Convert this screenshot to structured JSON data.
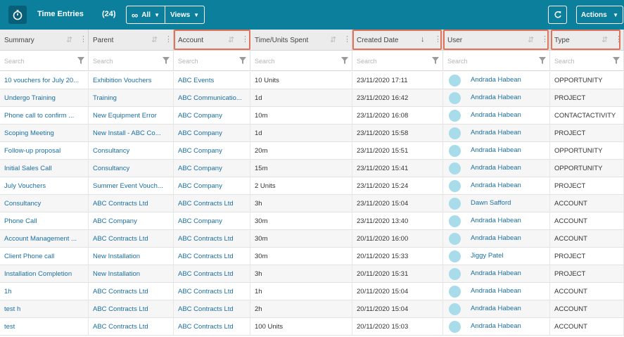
{
  "header": {
    "title": "Time Entries",
    "count": "(24)",
    "filter_label": "All",
    "views_label": "Views",
    "actions_label": "Actions",
    "timer_icon": "stopwatch-icon",
    "refresh_icon": "refresh-icon",
    "brand_color": "#0c7f9d"
  },
  "columns": [
    {
      "key": "summary",
      "label": "Summary",
      "search_placeholder": "Search"
    },
    {
      "key": "parent",
      "label": "Parent",
      "search_placeholder": "Search"
    },
    {
      "key": "account",
      "label": "Account",
      "search_placeholder": "Search"
    },
    {
      "key": "time",
      "label": "Time/Units Spent",
      "search_placeholder": "Search"
    },
    {
      "key": "created",
      "label": "Created Date",
      "search_placeholder": "Search"
    },
    {
      "key": "user",
      "label": "User",
      "search_placeholder": "Search"
    },
    {
      "key": "type",
      "label": "Type",
      "search_placeholder": "Search"
    }
  ],
  "highlight_color": "#e0735a",
  "rows": [
    {
      "summary": "10 vouchers for July 20...",
      "parent": "Exhibition Vouchers",
      "account": "ABC Events",
      "time": "10 Units",
      "created": "23/11/2020 17:11",
      "user": "Andrada Habean",
      "type": "OPPORTUNITY"
    },
    {
      "summary": "Undergo Training",
      "parent": "Training",
      "account": "ABC Communicatio...",
      "time": "1d",
      "created": "23/11/2020 16:42",
      "user": "Andrada Habean",
      "type": "PROJECT"
    },
    {
      "summary": "Phone call to confirm ...",
      "parent": "New Equipment Error",
      "account": "ABC Company",
      "time": "10m",
      "created": "23/11/2020 16:08",
      "user": "Andrada Habean",
      "type": "CONTACTACTIVITY"
    },
    {
      "summary": "Scoping Meeting",
      "parent": "New Install - ABC Co...",
      "account": "ABC Company",
      "time": "1d",
      "created": "23/11/2020 15:58",
      "user": "Andrada Habean",
      "type": "PROJECT"
    },
    {
      "summary": "Follow-up proposal",
      "parent": "Consultancy",
      "account": "ABC Company",
      "time": "20m",
      "created": "23/11/2020 15:51",
      "user": "Andrada Habean",
      "type": "OPPORTUNITY"
    },
    {
      "summary": "Initial Sales Call",
      "parent": "Consultancy",
      "account": "ABC Company",
      "time": "15m",
      "created": "23/11/2020 15:41",
      "user": "Andrada Habean",
      "type": "OPPORTUNITY"
    },
    {
      "summary": "July Vouchers",
      "parent": "Summer Event Vouch...",
      "account": "ABC Company",
      "time": "2 Units",
      "created": "23/11/2020 15:24",
      "user": "Andrada Habean",
      "type": "PROJECT"
    },
    {
      "summary": "Consultancy",
      "parent": "ABC Contracts Ltd",
      "account": "ABC Contracts Ltd",
      "time": "3h",
      "created": "23/11/2020 15:04",
      "user": "Dawn Safford",
      "type": "ACCOUNT"
    },
    {
      "summary": "Phone Call",
      "parent": "ABC Company",
      "account": "ABC Company",
      "time": "30m",
      "created": "23/11/2020 13:40",
      "user": "Andrada Habean",
      "type": "ACCOUNT"
    },
    {
      "summary": "Account Management ...",
      "parent": "ABC Contracts Ltd",
      "account": "ABC Contracts Ltd",
      "time": "30m",
      "created": "20/11/2020 16:00",
      "user": "Andrada Habean",
      "type": "ACCOUNT"
    },
    {
      "summary": "Client Phone call",
      "parent": "New Installation",
      "account": "ABC Contracts Ltd",
      "time": "30m",
      "created": "20/11/2020 15:33",
      "user": "Jiggy Patel",
      "type": "PROJECT"
    },
    {
      "summary": "Installation Completion",
      "parent": "New Installation",
      "account": "ABC Contracts Ltd",
      "time": "3h",
      "created": "20/11/2020 15:31",
      "user": "Andrada Habean",
      "type": "PROJECT"
    },
    {
      "summary": "1h",
      "parent": "ABC Contracts Ltd",
      "account": "ABC Contracts Ltd",
      "time": "1h",
      "created": "20/11/2020 15:04",
      "user": "Andrada Habean",
      "type": "ACCOUNT"
    },
    {
      "summary": "test h",
      "parent": "ABC Contracts Ltd",
      "account": "ABC Contracts Ltd",
      "time": "2h",
      "created": "20/11/2020 15:04",
      "user": "Andrada Habean",
      "type": "ACCOUNT"
    },
    {
      "summary": "test",
      "parent": "ABC Contracts Ltd",
      "account": "ABC Contracts Ltd",
      "time": "100 Units",
      "created": "20/11/2020 15:03",
      "user": "Andrada Habean",
      "type": "ACCOUNT"
    }
  ]
}
